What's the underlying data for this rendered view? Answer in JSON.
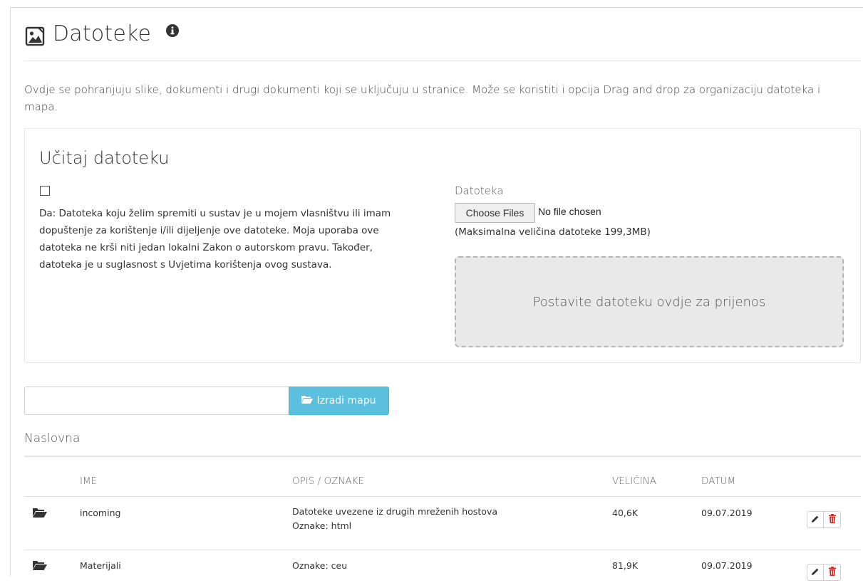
{
  "header": {
    "title": "Datoteke",
    "title_icon": "image-file-icon",
    "info_icon": "info-icon"
  },
  "intro": "Ovdje se pohranjuju slike, dokumenti i drugi dokumenti koji se uključuju u stranice. Može se koristiti i opcija Drag and drop za organizaciju datoteka i mapa.",
  "upload": {
    "heading": "Učitaj datoteku",
    "consent_checked": false,
    "consent_text": "Da: Datoteka koju želim spremiti u sustav je u mojem vlasništvu ili imam dopuštenje za korištenje i/ili dijeljenje ove datoteke. Moja uporaba ove datoteka ne krši niti jedan lokalni Zakon o autorskom pravu. Također, datoteka je u suglasnost s Uvjetima korištenja ovog sustava.",
    "file_label": "Datoteka",
    "choose_files": "Choose Files",
    "no_file": "No file chosen",
    "max_size": "(Maksimalna veličina datoteke 199,3MB)",
    "dropzone": "Postavite datoteku ovdje za prijenos"
  },
  "folder": {
    "input_value": "",
    "create_button": "Izradi mapu",
    "button_color": "#5bc0de"
  },
  "listing": {
    "section_title": "Naslovna",
    "columns": {
      "name": "IME",
      "description": "OPIS / OZNAKE",
      "size": "VELIČINA",
      "date": "DATUM"
    },
    "rows": [
      {
        "icon": "folder-open-icon",
        "name": "incoming",
        "description": "Datoteke uvezene iz drugih mreženih hostova",
        "tags": "Oznake: html",
        "size": "40,6K",
        "date": "09.07.2019"
      },
      {
        "icon": "folder-open-icon",
        "name": "Materijali",
        "description": "",
        "tags": "Oznake: ceu",
        "size": "81,9K",
        "date": "09.07.2019"
      }
    ],
    "delete_color": "#c9302c"
  }
}
